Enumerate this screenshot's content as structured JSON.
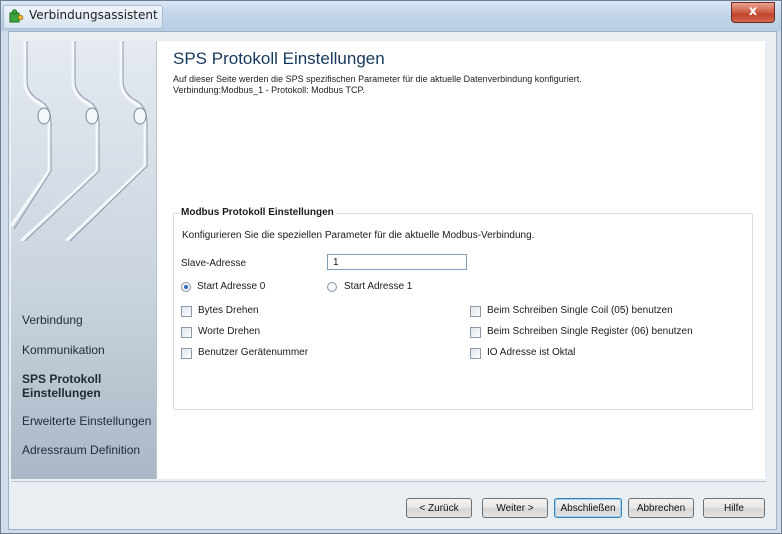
{
  "window": {
    "title": "Verbindungsassistent",
    "close_label": "x"
  },
  "sidebar": {
    "items": [
      {
        "label": "Verbindung"
      },
      {
        "label": "Kommunikation"
      },
      {
        "label": "SPS Protokoll Einstellungen",
        "label_line1": "SPS Protokoll",
        "label_line2": "Einstellungen",
        "active": true
      },
      {
        "label": "Erweiterte Einstellungen"
      },
      {
        "label": "Adressraum Definition"
      }
    ]
  },
  "page": {
    "title": "SPS Protokoll Einstellungen",
    "description": "Auf dieser Seite werden die SPS spezifischen Parameter für die aktuelle Datenverbindung konfiguriert.",
    "connection_info": "Verbindung:Modbus_1 - Protokoll: Modbus TCP."
  },
  "modbus": {
    "group_title": "Modbus Protokoll Einstellungen",
    "hint": "Konfigurieren Sie die speziellen Parameter für die aktuelle Modbus-Verbindung.",
    "slave_label": "Slave-Adresse",
    "slave_value": "1",
    "radio_start0": "Start Adresse 0",
    "radio_start1": "Start Adresse 1",
    "selected_start": "Start Adresse 0",
    "checkboxes": {
      "bytes_drehen": {
        "label": "Bytes Drehen",
        "checked": false
      },
      "worte_drehen": {
        "label": "Worte Drehen",
        "checked": false
      },
      "benutzer_geraetenummer": {
        "label": "Benutzer Gerätenummer",
        "checked": false
      },
      "single_coil": {
        "label": "Beim Schreiben Single Coil (05) benutzen",
        "checked": false
      },
      "single_register": {
        "label": "Beim Schreiben Single Register (06) benutzen",
        "checked": false
      },
      "io_oktal": {
        "label": "IO Adresse ist Oktal",
        "checked": false
      }
    }
  },
  "buttons": {
    "back": "< Zurück",
    "next": "Weiter >",
    "finish": "Abschließen",
    "cancel": "Abbrechen",
    "help": "Hilfe"
  }
}
